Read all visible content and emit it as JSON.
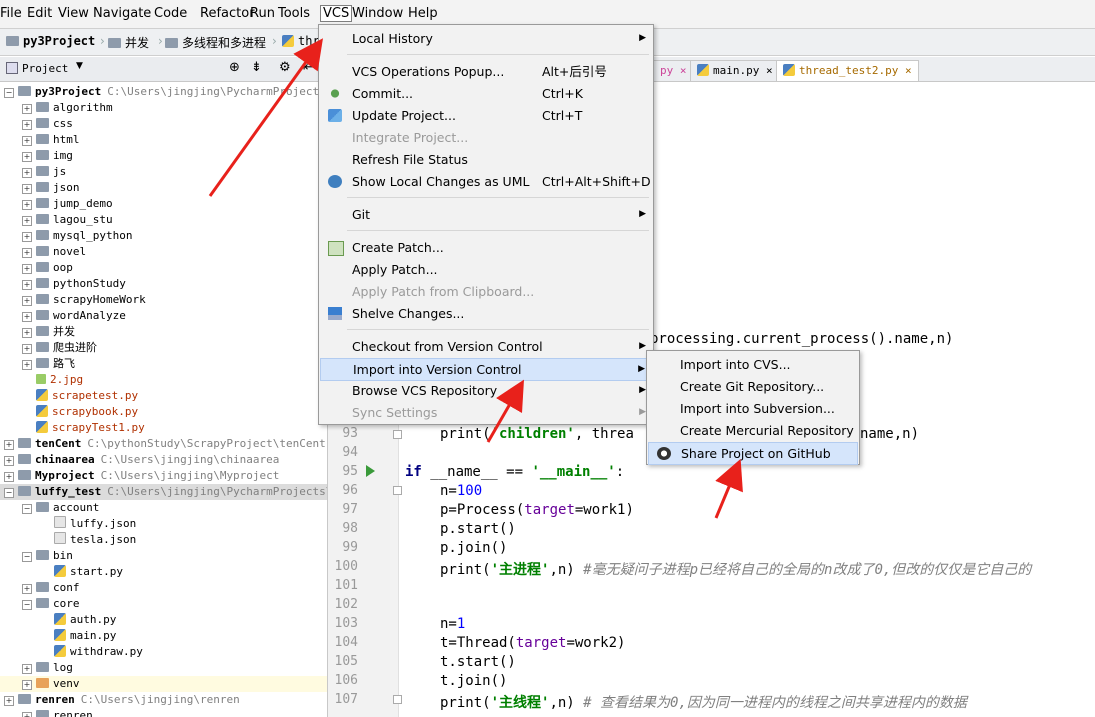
{
  "menubar": [
    "File",
    "Edit",
    "View",
    "Navigate",
    "Code",
    "Refactor",
    "Run",
    "Tools",
    "VCS",
    "Window",
    "Help"
  ],
  "breadcrumb": [
    "py3Project",
    "并发",
    "多线程和多进程",
    "thr"
  ],
  "project_panel": {
    "title": "Project"
  },
  "tree": [
    {
      "label": "py3Project",
      "path": "C:\\Users\\jingjing\\PycharmProjects\\",
      "bold": true
    },
    {
      "label": "algorithm"
    },
    {
      "label": "css"
    },
    {
      "label": "html"
    },
    {
      "label": "img"
    },
    {
      "label": "js"
    },
    {
      "label": "json"
    },
    {
      "label": "jump_demo"
    },
    {
      "label": "lagou_stu"
    },
    {
      "label": "mysql_python"
    },
    {
      "label": "novel"
    },
    {
      "label": "oop"
    },
    {
      "label": "pythonStudy"
    },
    {
      "label": "scrapyHomeWork"
    },
    {
      "label": "wordAnalyze"
    },
    {
      "label": "并发"
    },
    {
      "label": "爬虫进阶"
    },
    {
      "label": "路飞"
    },
    {
      "label": "2.jpg"
    },
    {
      "label": "scrapetest.py"
    },
    {
      "label": "scrapybook.py"
    },
    {
      "label": "scrapyTest1.py"
    },
    {
      "label": "tenCent",
      "path": "C:\\pythonStudy\\ScrapyProject\\tenCent",
      "bold": true
    },
    {
      "label": "chinaarea",
      "path": "C:\\Users\\jingjing\\chinaarea",
      "bold": true
    },
    {
      "label": "Myproject",
      "path": "C:\\Users\\jingjing\\Myproject",
      "bold": true
    },
    {
      "label": "luffy_test",
      "path": "C:\\Users\\jingjing\\PycharmProjects\\lu",
      "bold": true
    },
    {
      "label": "account"
    },
    {
      "label": "luffy.json"
    },
    {
      "label": "tesla.json"
    },
    {
      "label": "bin"
    },
    {
      "label": "start.py"
    },
    {
      "label": "conf"
    },
    {
      "label": "core"
    },
    {
      "label": "auth.py"
    },
    {
      "label": "main.py"
    },
    {
      "label": "withdraw.py"
    },
    {
      "label": "log"
    },
    {
      "label": "venv"
    },
    {
      "label": "renren",
      "path": "C:\\Users\\jingjing\\renren",
      "bold": true
    },
    {
      "label": "renren"
    }
  ],
  "tabs": [
    "py",
    "main.py",
    "thread_test2.py"
  ],
  "code_lines": [
    {
      "n": "93",
      "text": ""
    },
    {
      "n": "94",
      "text": ""
    },
    {
      "n": "95",
      "text": ""
    },
    {
      "n": "96",
      "text": ""
    },
    {
      "n": "97",
      "text": ""
    },
    {
      "n": "98",
      "text": ""
    },
    {
      "n": "99",
      "text": ""
    },
    {
      "n": "100",
      "text": ""
    },
    {
      "n": "101",
      "text": ""
    },
    {
      "n": "102",
      "text": ""
    },
    {
      "n": "103",
      "text": ""
    },
    {
      "n": "104",
      "text": ""
    },
    {
      "n": "105",
      "text": ""
    },
    {
      "n": "106",
      "text": ""
    },
    {
      "n": "107",
      "text": ""
    }
  ],
  "code_fragments": {
    "l92": "processing.current_process().name,n)",
    "l93a": "print(",
    "l93b": "'children'",
    "l93c": ", threa",
    "l93d": "name,n)",
    "l95a": "if",
    "l95b": " __name__ == ",
    "l95c": "'__main__'",
    "l95d": ":",
    "l96a": "n=",
    "l96b": "100",
    "l97a": "p=Process(",
    "l97b": "target",
    "l97c": "=work1)",
    "l98": "p.start()",
    "l99": "p.join()",
    "l100a": "print(",
    "l100b": "'主进程'",
    "l100c": ",n)  ",
    "l100d": "#毫无疑问子进程p已经将自己的全局的n改成了0,但改的仅仅是它自己的",
    "l103a": "n=",
    "l103b": "1",
    "l104a": "t=Thread(",
    "l104b": "target",
    "l104c": "=work2)",
    "l105": "t.start()",
    "l106": "t.join()",
    "l107a": "print(",
    "l107b": "'主线程'",
    "l107c": ",n)  ",
    "l107d": "# 查看结果为0,因为同一进程内的线程之间共享进程内的数据"
  },
  "vcs_menu": [
    {
      "label": "Local History",
      "submenu": true
    },
    {
      "sep": true
    },
    {
      "label": "VCS Operations Popup...",
      "shortcut": "Alt+后引号"
    },
    {
      "label": "Commit...",
      "shortcut": "Ctrl+K",
      "icon": "commit-icon"
    },
    {
      "label": "Update Project...",
      "shortcut": "Ctrl+T",
      "icon": "update-icon"
    },
    {
      "label": "Integrate Project...",
      "disabled": true
    },
    {
      "label": "Refresh File Status"
    },
    {
      "label": "Show Local Changes as UML",
      "shortcut": "Ctrl+Alt+Shift+D",
      "icon": "uml-icon"
    },
    {
      "sep": true
    },
    {
      "label": "Git",
      "submenu": true
    },
    {
      "sep": true
    },
    {
      "label": "Create Patch...",
      "icon": "patch-icon"
    },
    {
      "label": "Apply Patch..."
    },
    {
      "label": "Apply Patch from Clipboard...",
      "disabled": true
    },
    {
      "label": "Shelve Changes...",
      "icon": "shelve-icon"
    },
    {
      "sep": true
    },
    {
      "label": "Checkout from Version Control",
      "submenu": true
    },
    {
      "label": "Import into Version Control",
      "submenu": true,
      "highlight": true
    },
    {
      "label": "Browse VCS Repository",
      "submenu": true
    },
    {
      "label": "Sync Settings",
      "submenu": true,
      "disabled": true
    }
  ],
  "import_submenu": [
    {
      "label": "Import into CVS..."
    },
    {
      "label": "Create Git Repository..."
    },
    {
      "label": "Import into Subversion..."
    },
    {
      "label": "Create Mercurial Repository"
    },
    {
      "label": "Share Project on GitHub",
      "icon": "github-icon",
      "highlight": true
    }
  ],
  "colors": {
    "arrow": "#e8211b",
    "highlight": "#d5e5fb",
    "keyword": "#000080",
    "string": "#008000",
    "number": "#0000ff",
    "comment": "#808080"
  }
}
